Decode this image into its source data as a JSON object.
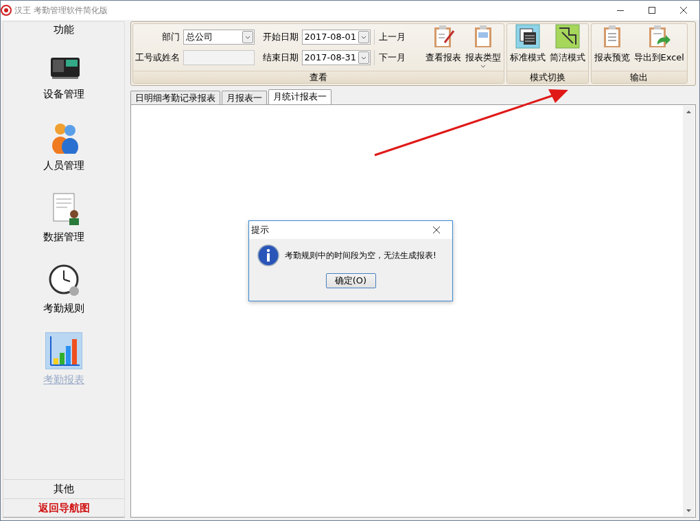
{
  "window": {
    "title": "汉王 考勤管理软件简化版"
  },
  "sidebar": {
    "header": "功能",
    "items": [
      {
        "label": "设备管理",
        "selected": false
      },
      {
        "label": "人员管理",
        "selected": false
      },
      {
        "label": "数据管理",
        "selected": false
      },
      {
        "label": "考勤规则",
        "selected": false
      },
      {
        "label": "考勤报表",
        "selected": true
      }
    ],
    "footer": [
      {
        "label": "其他",
        "kind": "plain"
      },
      {
        "label": "返回导航图",
        "kind": "emphasis"
      }
    ]
  },
  "ribbon": {
    "query": {
      "caption": "查看",
      "department": {
        "label": "部门",
        "value": "总公司"
      },
      "employee": {
        "label": "工号或姓名"
      },
      "start_date": {
        "label": "开始日期",
        "value": "2017-08-01"
      },
      "end_date": {
        "label": "结束日期",
        "value": "2017-08-31"
      },
      "month_buttons": [
        "上一月",
        "下一月"
      ],
      "buttons": [
        {
          "label": "查看报表",
          "dropdown": false
        },
        {
          "label": "报表类型",
          "dropdown": true
        }
      ]
    },
    "groups": [
      {
        "caption": "模式切换",
        "buttons": [
          {
            "label": "标准模式"
          },
          {
            "label": "简洁模式"
          }
        ]
      },
      {
        "caption": "输出",
        "buttons": [
          {
            "label": "报表预览"
          },
          {
            "label": "导出到Excel"
          }
        ]
      }
    ]
  },
  "tabs": [
    {
      "label": "日明细考勤记录报表",
      "selected": false
    },
    {
      "label": "月报表一",
      "selected": false
    },
    {
      "label": "月统计报表一",
      "selected": true
    }
  ],
  "dialog": {
    "title": "提示",
    "message": "考勤规则中的时间段为空，无法生成报表!",
    "button": "确定(O)"
  }
}
